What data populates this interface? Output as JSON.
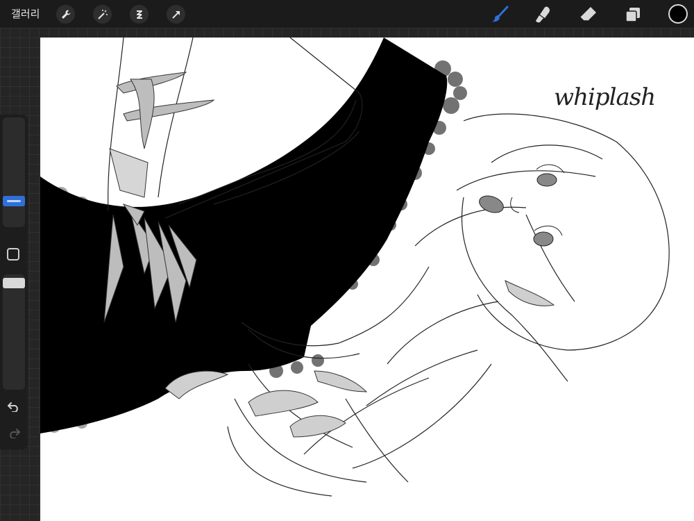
{
  "toolbar": {
    "gallery_label": "갤러리",
    "left_tools": [
      "wrench-icon",
      "magic-wand-icon",
      "selection-icon",
      "transform-arrow-icon"
    ],
    "right_tools": [
      "brush-icon",
      "smudge-icon",
      "eraser-icon",
      "layers-icon"
    ],
    "active_tool": "brush",
    "active_color": "#000000",
    "accent": "#2f6fd9"
  },
  "canvas": {
    "title_text": "whiplash",
    "background": "#ffffff"
  },
  "sidebar": {
    "brush_size_level": 0.18,
    "opacity_level": 0.03,
    "buttons": [
      "modify-square-icon",
      "undo-icon",
      "redo-icon"
    ]
  }
}
